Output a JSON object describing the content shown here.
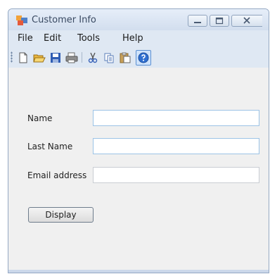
{
  "window": {
    "title": "Customer Info"
  },
  "menu": {
    "items": [
      "File",
      "Edit",
      "Tools",
      "Help"
    ]
  },
  "toolbar": {
    "buttons": [
      "new-icon",
      "open-icon",
      "save-icon",
      "print-icon",
      "cut-icon",
      "copy-icon",
      "paste-icon",
      "help-icon"
    ]
  },
  "form": {
    "fields": [
      {
        "label": "Name",
        "value": ""
      },
      {
        "label": "Last Name",
        "value": ""
      },
      {
        "label": "Email address",
        "value": ""
      }
    ],
    "display_label": "Display"
  },
  "colors": {
    "frame": "#dfe8f3",
    "client": "#f0f0f0",
    "focus_border": "#9cc3e6"
  }
}
